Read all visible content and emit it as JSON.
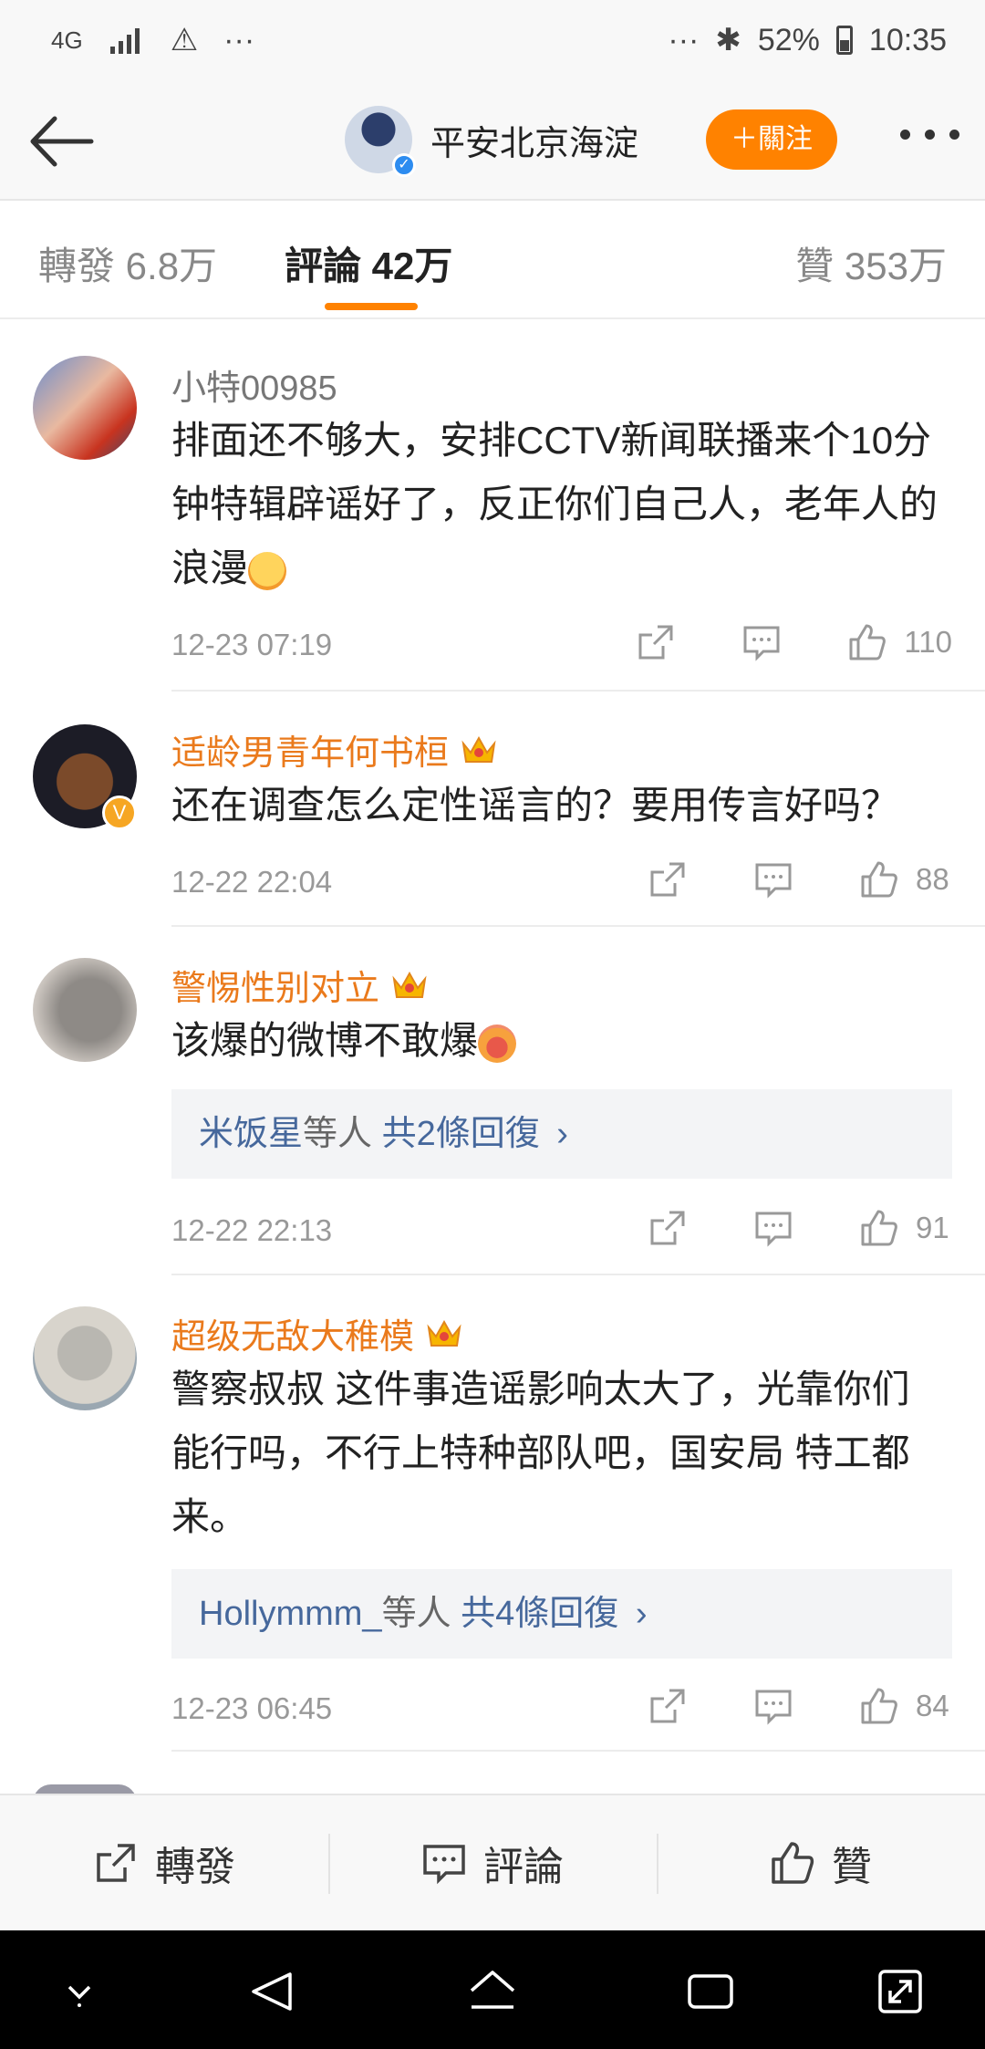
{
  "status_bar": {
    "network": "4G",
    "alert": "⚠",
    "dots_left": "···",
    "dots_right": "···",
    "bluetooth": "✱",
    "battery": "52%",
    "time": "10:35"
  },
  "header": {
    "account_name": "平安北京海淀",
    "follow_label": "＋關注"
  },
  "tabs": [
    {
      "label": "轉發 6.8万"
    },
    {
      "label": "評論 42万"
    },
    {
      "label": "贊 353万"
    }
  ],
  "comments": [
    {
      "user": "小特00985",
      "text": "排面还不够大，安排CCTV新闻联播来个10分钟特辑辟谣好了，反正你们自己人，老年人的浪漫",
      "time": "12-23 07:19",
      "likes": "110"
    },
    {
      "user": "适龄男青年何书桓",
      "text": "还在调查怎么定性谣言的？要用传言好吗？",
      "time": "12-22 22:04",
      "likes": "88"
    },
    {
      "user": "警惕性别对立",
      "text": "该爆的微博不敢爆",
      "reply_user": "米饭星",
      "reply_mid": "等人",
      "reply_count": "共2條回復",
      "time": "12-22 22:13",
      "likes": "91"
    },
    {
      "user": "超级无敌大稚模",
      "text": "警察叔叔 这件事造谣影响太大了，光靠你们能行吗，不行上特种部队吧，国安局 特工都来。",
      "reply_user": "Hollymmm_",
      "reply_mid": "等人",
      "reply_count": "共4條回復",
      "time": "12-23 06:45",
      "likes": "84"
    }
  ],
  "reply_chevron": "›",
  "action_bar": {
    "repost": "轉發",
    "comment": "評論",
    "like": "贊"
  },
  "colors": {
    "accent": "#ff8200",
    "vip_name": "#ea7a1c",
    "link_blue": "#46689c"
  },
  "icons": [
    "back-arrow-icon",
    "share-icon",
    "comment-icon",
    "like-icon",
    "crown-icon",
    "nav-back-icon",
    "nav-home-icon",
    "nav-recents-icon"
  ]
}
